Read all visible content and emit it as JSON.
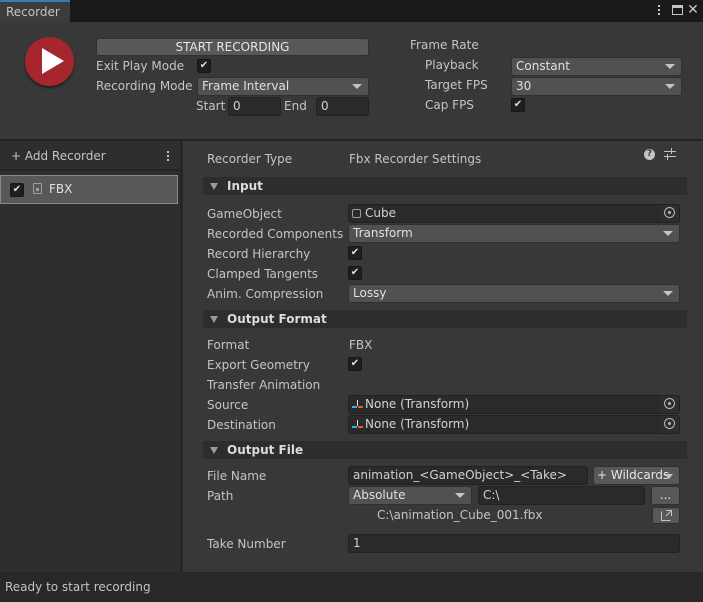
{
  "window": {
    "tab_title": "Recorder",
    "menu_icon": "kebab-menu-icon",
    "maximize_icon": "maximize-icon",
    "close_icon": "close-icon"
  },
  "top": {
    "start_recording_label": "START RECORDING",
    "exit_play_mode_label": "Exit Play Mode",
    "exit_play_mode_checked": true,
    "recording_mode_label": "Recording Mode",
    "recording_mode_value": "Frame Interval",
    "start_label": "Start",
    "start_value": "0",
    "end_label": "End",
    "end_value": "0",
    "frame_rate_label": "Frame Rate",
    "playback_label": "Playback",
    "playback_value": "Constant",
    "target_fps_label": "Target FPS",
    "target_fps_value": "30",
    "cap_fps_label": "Cap FPS",
    "cap_fps_checked": true
  },
  "sidebar": {
    "add_recorder_label": "+ Add Recorder",
    "recorders": [
      {
        "name": "FBX",
        "enabled": true,
        "selected": true
      }
    ]
  },
  "settings": {
    "recorder_type_label": "Recorder Type",
    "recorder_type_value": "Fbx Recorder Settings",
    "sections": {
      "input": {
        "title": "Input",
        "gameobject_label": "GameObject",
        "gameobject_value": "Cube",
        "recorded_components_label": "Recorded Components",
        "recorded_components_value": "Transform",
        "record_hierarchy_label": "Record Hierarchy",
        "record_hierarchy_checked": true,
        "clamped_tangents_label": "Clamped Tangents",
        "clamped_tangents_checked": true,
        "anim_compression_label": "Anim. Compression",
        "anim_compression_value": "Lossy"
      },
      "output_format": {
        "title": "Output Format",
        "format_label": "Format",
        "format_value": "FBX",
        "export_geometry_label": "Export Geometry",
        "export_geometry_checked": true,
        "transfer_animation_label": "Transfer Animation",
        "source_label": "Source",
        "source_value": "None (Transform)",
        "destination_label": "Destination",
        "destination_value": "None (Transform)"
      },
      "output_file": {
        "title": "Output File",
        "file_name_label": "File Name",
        "file_name_value": "animation_<GameObject>_<Take>",
        "wildcards_label": "+ Wildcards",
        "path_label": "Path",
        "path_type_value": "Absolute",
        "path_value": "C:\\",
        "browse_label": "...",
        "resolved_path": "C:\\animation_Cube_001.fbx",
        "take_number_label": "Take Number",
        "take_number_value": "1"
      }
    }
  },
  "status_bar": {
    "message": "Ready to start recording"
  },
  "check_glyph": "✔"
}
